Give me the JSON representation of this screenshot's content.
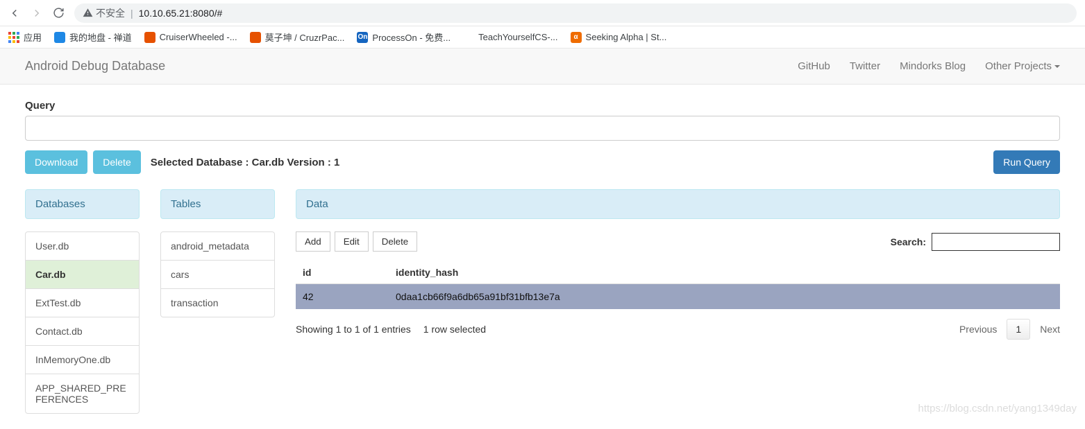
{
  "browser": {
    "insecure_label": "不安全",
    "url": "10.10.65.21:8080/#"
  },
  "bookmarks": {
    "apps": "应用",
    "items": [
      {
        "label": "我的地盘 - 禅道",
        "bg": "#1e88e5"
      },
      {
        "label": "CruiserWheeled -...",
        "bg": "#e65100"
      },
      {
        "label": "莫子坤 / CruzrPac...",
        "bg": "#e65100"
      },
      {
        "label": "ProcessOn - 免费...",
        "bg": "#1565c0",
        "text": "On"
      },
      {
        "label": "TeachYourselfCS-...",
        "bg": "#24292e",
        "gh": true
      },
      {
        "label": "Seeking Alpha | St...",
        "bg": "#ef6c00",
        "text": "α"
      }
    ]
  },
  "nav": {
    "brand": "Android Debug Database",
    "links": [
      "GitHub",
      "Twitter",
      "Mindorks Blog",
      "Other Projects"
    ]
  },
  "query": {
    "label": "Query",
    "value": "",
    "download": "Download",
    "delete": "Delete",
    "selected_prefix": "Selected Database : ",
    "selected_db": "Car.db",
    "version_prefix": " Version : ",
    "version": "1",
    "run": "Run Query"
  },
  "panels": {
    "databases": "Databases",
    "tables": "Tables",
    "data": "Data"
  },
  "databases": [
    {
      "name": "User.db",
      "active": false
    },
    {
      "name": "Car.db",
      "active": true
    },
    {
      "name": "ExtTest.db",
      "active": false
    },
    {
      "name": "Contact.db",
      "active": false
    },
    {
      "name": "InMemoryOne.db",
      "active": false
    },
    {
      "name": "APP_SHARED_PREFERENCES",
      "active": false
    }
  ],
  "tables": [
    "android_metadata",
    "cars",
    "transaction"
  ],
  "data_toolbar": {
    "add": "Add",
    "edit": "Edit",
    "delete": "Delete",
    "search_label": "Search:",
    "search_value": ""
  },
  "table": {
    "columns": [
      "id",
      "identity_hash"
    ],
    "rows": [
      {
        "id": "42",
        "identity_hash": "0daa1cb66f9a6db65a91bf31bfb13e7a",
        "selected": true
      }
    ]
  },
  "footer": {
    "showing": "Showing 1 to 1 of 1 entries",
    "selected": "1 row selected",
    "previous": "Previous",
    "page": "1",
    "next": "Next"
  },
  "watermark": "https://blog.csdn.net/yang1349day"
}
